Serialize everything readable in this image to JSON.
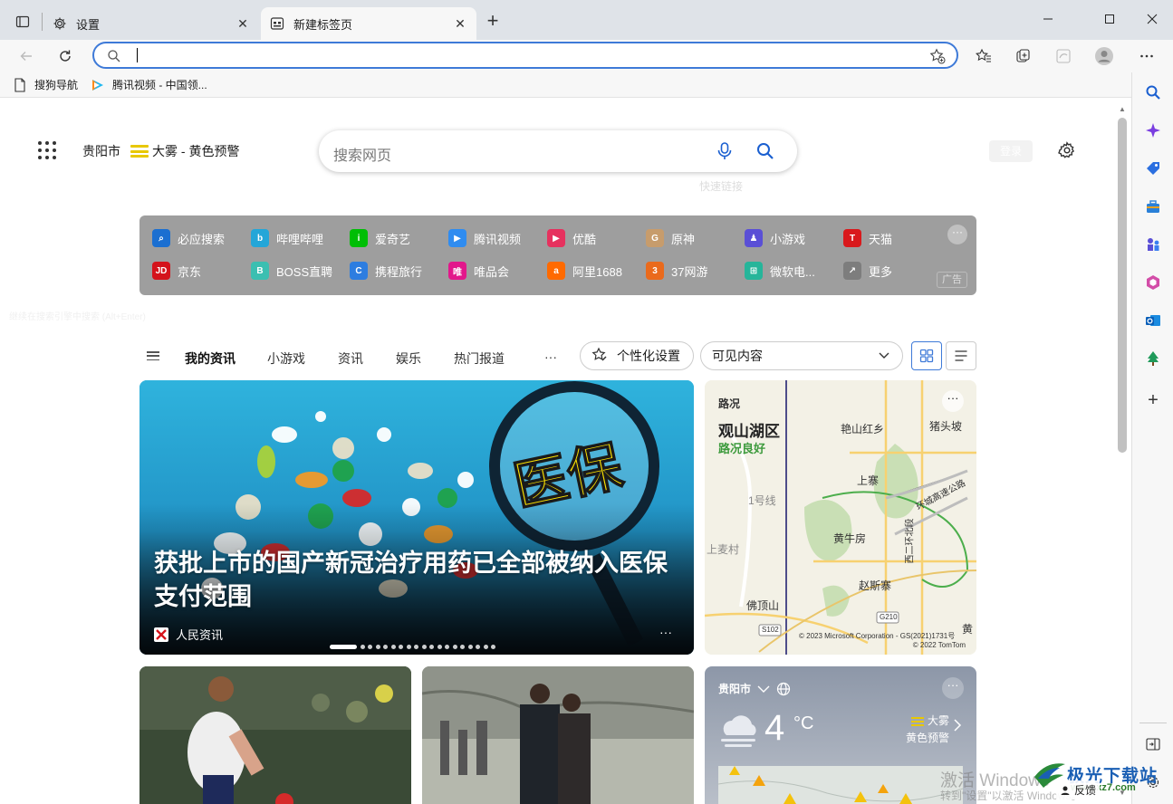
{
  "tabs": [
    {
      "label": "设置",
      "icon": "gear-icon"
    },
    {
      "label": "新建标签页",
      "icon": "newtab-page-icon"
    }
  ],
  "addressbar": {
    "value": ""
  },
  "bookmarks": [
    {
      "label": "搜狗导航",
      "icon": "page-icon"
    },
    {
      "label": "腾讯视频 - 中国领...",
      "icon": "tencent-video-icon"
    }
  ],
  "newtab": {
    "location": "贵阳市",
    "weather_alert": "大雾 - 黄色预警",
    "search_placeholder": "搜索网页",
    "quicklinks_ghost": "快速链接",
    "login_ghost": "登录",
    "ghost_line": "继续在搜索引擎中搜索 (Alt+Enter)",
    "quicklinks": [
      {
        "label": "必应搜索",
        "icon": "bing-search-icon",
        "color": "#1b6fd1"
      },
      {
        "label": "哔哩哔哩",
        "icon": "bilibili-icon",
        "color": "#24a6d8"
      },
      {
        "label": "爱奇艺",
        "icon": "iqiyi-icon",
        "color": "#00be06"
      },
      {
        "label": "腾讯视频",
        "icon": "tencent-video-icon",
        "color": "#2f8cf0"
      },
      {
        "label": "优酷",
        "icon": "youku-icon",
        "color": "#e6315e"
      },
      {
        "label": "原神",
        "icon": "genshin-icon",
        "color": "#c79c6c"
      },
      {
        "label": "小游戏",
        "icon": "minigame-icon",
        "color": "#5a4fd6"
      },
      {
        "label": "天猫",
        "icon": "tmall-icon",
        "color": "#d9191c"
      },
      {
        "label": "京东",
        "icon": "jd-icon",
        "color": "#d4131b"
      },
      {
        "label": "BOSS直聘",
        "icon": "boss-icon",
        "color": "#3bbfb1"
      },
      {
        "label": "携程旅行",
        "icon": "ctrip-icon",
        "color": "#2d7de0"
      },
      {
        "label": "唯品会",
        "icon": "vip-icon",
        "color": "#e2178b"
      },
      {
        "label": "阿里1688",
        "icon": "ali1688-icon",
        "color": "#ff6a00"
      },
      {
        "label": "37网游",
        "icon": "37games-icon",
        "color": "#ea6a1c"
      },
      {
        "label": "微软电...",
        "icon": "msstore-icon",
        "color": "#26b59a"
      },
      {
        "label": "更多",
        "icon": "more-share-icon",
        "color": "#7d7d7d"
      }
    ],
    "ad_tag": "广告",
    "more_dots": "···"
  },
  "feednav": {
    "items": [
      "我的资讯",
      "小游戏",
      "资讯",
      "娱乐",
      "热门报道",
      "···"
    ],
    "personalize_label": "个性化设置",
    "visible_select": "可见内容"
  },
  "hero": {
    "title": "获批上市的国产新冠治疗用药已全部被纳入医保支付范围",
    "image_text": "医保",
    "source": "人民资讯",
    "more": "···"
  },
  "traffic": {
    "label": "路况",
    "place": "观山湖区",
    "status": "路况良好",
    "more": "···",
    "map_labels": [
      "艳山红乡",
      "猪头坡",
      "上寨",
      "1号线",
      "环城高速公路",
      "黄牛房",
      "上麦村",
      "西二环北段",
      "赵斯寨",
      "佛顶山",
      "S102",
      "G210",
      "黄"
    ],
    "copyright_1": "© 2023 Microsoft Corporation - GS(2021)1731号",
    "copyright_2": "© 2022 TomTom"
  },
  "weather": {
    "city": "贵阳市",
    "temp": "4",
    "unit": "°C",
    "alert_title": "大雾",
    "alert_level": "黄色预警",
    "more": "···"
  },
  "overlay": {
    "watermark": "激活 Windows",
    "watermark_sub": "转到\"设置\"以激活 Windows。",
    "feedback": "反馈",
    "site_logo": "极光下载站",
    "site_url": "www.xz7.com"
  },
  "colors": {
    "accent": "#3e7ad8",
    "quicklinks_bg": "#9e9e9e",
    "traffic_good": "#3c9a3c",
    "fog_alert": "#e8c800"
  }
}
